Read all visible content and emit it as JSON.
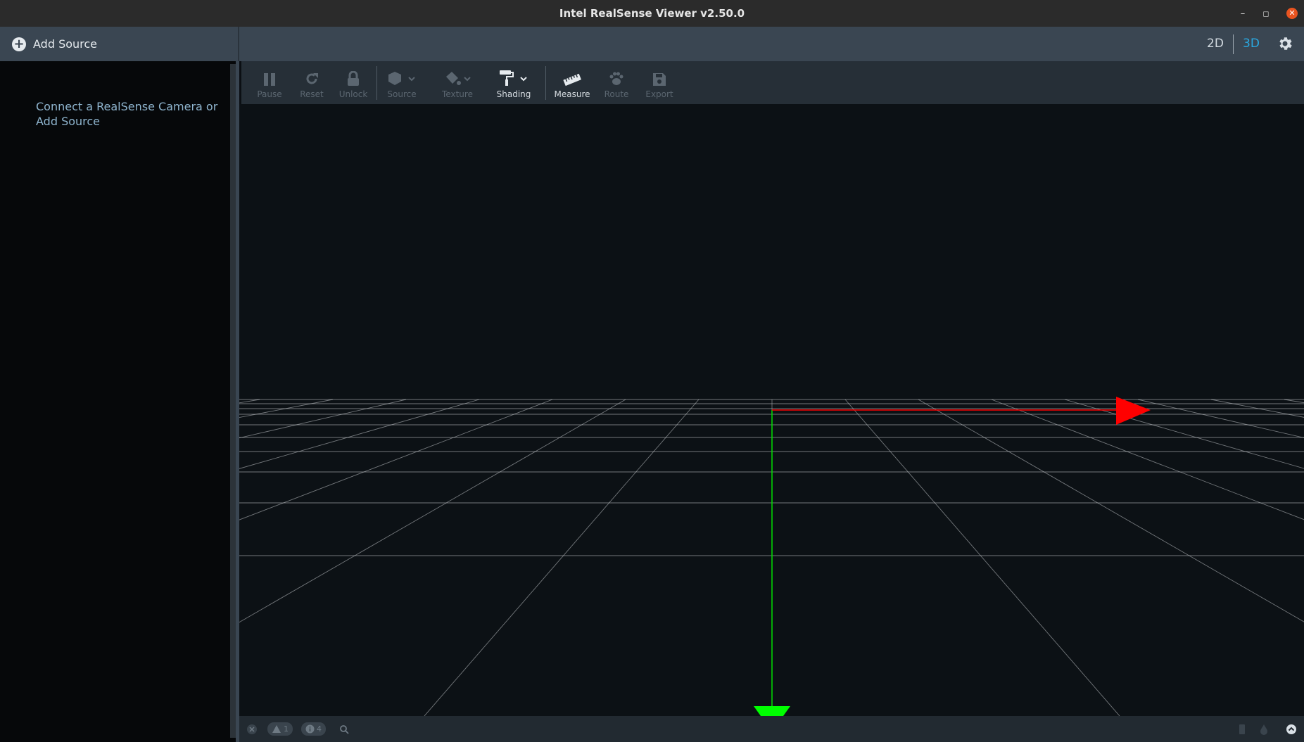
{
  "window": {
    "title": "Intel RealSense Viewer v2.50.0",
    "minimize_glyph": "–",
    "maximize_glyph": "◻",
    "close_glyph": "✕"
  },
  "left_panel": {
    "add_source_label": "Add Source",
    "connect_message": "Connect a RealSense Camera or Add Source"
  },
  "header": {
    "view_2d_label": "2D",
    "view_3d_label": "3D",
    "active_view": "3D",
    "active_color": "#2aa8e0"
  },
  "toolbar": {
    "pause_label": "Pause",
    "reset_label": "Reset",
    "unlock_label": "Unlock",
    "source_label": "Source",
    "texture_label": "Texture",
    "shading_label": "Shading",
    "measure_label": "Measure",
    "route_label": "Route",
    "export_label": "Export"
  },
  "statusbar": {
    "warnings_count": "1",
    "info_count": "4"
  },
  "axes_colors": {
    "x_axis": "#ff0000",
    "y_axis": "#00ff00",
    "grid": "#c8ccd0"
  }
}
